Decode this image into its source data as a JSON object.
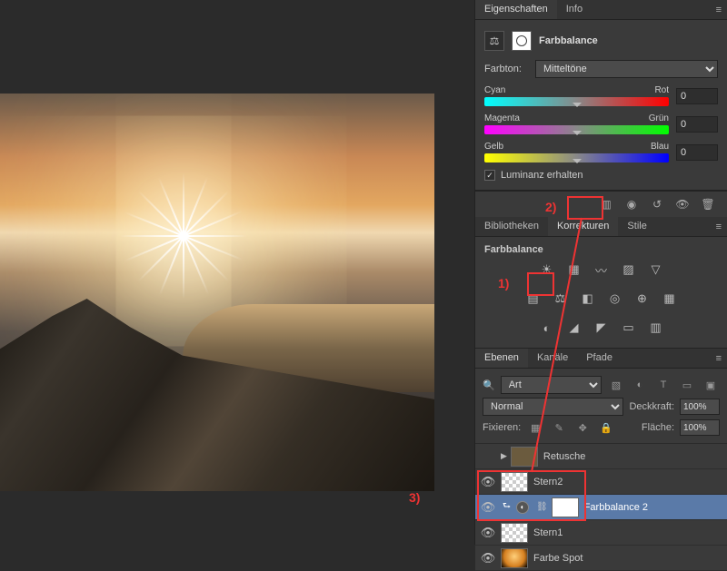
{
  "properties": {
    "tab_eigenschaften": "Eigenschaften",
    "tab_info": "Info",
    "title": "Farbbalance",
    "farbton_label": "Farbton:",
    "farbton_value": "Mitteltöne",
    "sliders": [
      {
        "left": "Cyan",
        "right": "Rot",
        "value": "0"
      },
      {
        "left": "Magenta",
        "right": "Grün",
        "value": "0"
      },
      {
        "left": "Gelb",
        "right": "Blau",
        "value": "0"
      }
    ],
    "luminance": "Luminanz erhalten"
  },
  "adjustments": {
    "tab_bib": "Bibliotheken",
    "tab_korr": "Korrekturen",
    "tab_stile": "Stile",
    "title": "Farbbalance"
  },
  "layers": {
    "tab_ebenen": "Ebenen",
    "tab_kanale": "Kanäle",
    "tab_pfade": "Pfade",
    "filter_kind": "Art",
    "blend_mode": "Normal",
    "opacity_label": "Deckkraft:",
    "opacity_value": "100%",
    "lock_label": "Fixieren:",
    "fill_label": "Fläche:",
    "fill_value": "100%",
    "items": [
      {
        "name": "Retusche",
        "type": "group"
      },
      {
        "name": "Stern2",
        "type": "layer"
      },
      {
        "name": "Farbbalance 2",
        "type": "adjustment"
      },
      {
        "name": "Stern1",
        "type": "layer"
      },
      {
        "name": "Farbe Spot",
        "type": "layer"
      }
    ]
  },
  "annotations": {
    "one": "1)",
    "two": "2)",
    "three": "3)"
  }
}
